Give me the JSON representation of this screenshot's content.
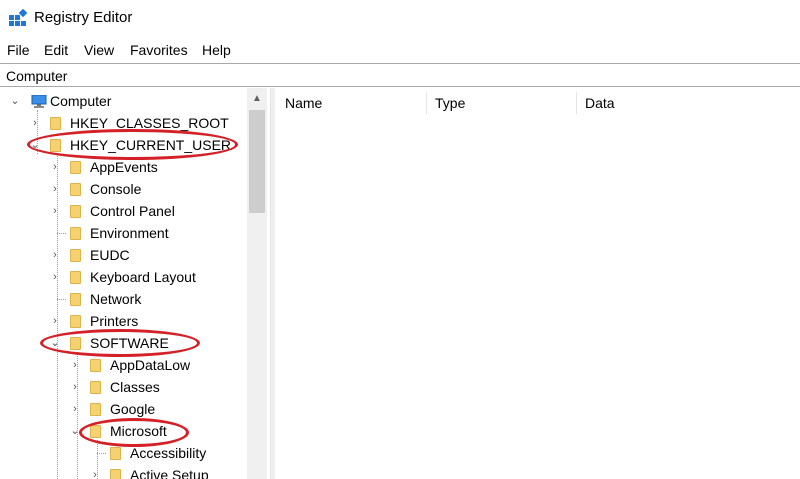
{
  "window": {
    "title": "Registry Editor"
  },
  "menu": [
    "File",
    "Edit",
    "View",
    "Favorites",
    "Help"
  ],
  "address": {
    "value": "Computer"
  },
  "tree": {
    "root": "Computer",
    "nodes": [
      "HKEY_CLASSES_ROOT",
      "HKEY_CURRENT_USER",
      "AppEvents",
      "Console",
      "Control Panel",
      "Environment",
      "EUDC",
      "Keyboard Layout",
      "Network",
      "Printers",
      "SOFTWARE",
      "AppDataLow",
      "Classes",
      "Google",
      "Microsoft",
      "Accessibility",
      "Active Setup"
    ]
  },
  "columns": {
    "name": "Name",
    "type": "Type",
    "data": "Data"
  },
  "annotation_color": "#d42027"
}
